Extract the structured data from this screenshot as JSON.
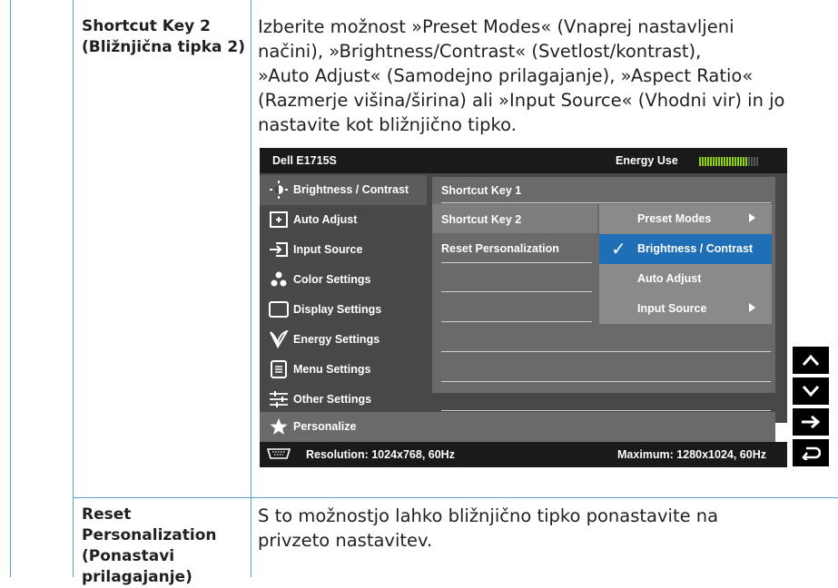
{
  "rows": [
    {
      "title_lines": [
        "Shortcut Key 2",
        "(Bližnjična tipka 2)"
      ],
      "description_lines": [
        "Izberite možnost »Preset Modes« (Vnaprej nastavljeni",
        "načini), »Brightness/Contrast« (Svetlost/kontrast),",
        "»Auto Adjust« (Samodejno prilagajanje), »Aspect Ratio«",
        "(Razmerje višina/širina) ali »Input Source« (Vhodni vir) in jo",
        "nastavite kot bližnjično tipko."
      ]
    },
    {
      "title_lines": [
        "Reset",
        "Personalization",
        "(Ponastavi",
        "prilagajanje)"
      ],
      "description_lines": [
        "S to možnostjo lahko bližnjično tipko ponastavite na",
        "privzeto nastavitev."
      ]
    }
  ],
  "osd": {
    "model": "Dell E1715S",
    "energy_label": "Energy Use",
    "energy_level_fraction": 0.83,
    "menu_items": [
      {
        "label": "Brightness / Contrast",
        "icon": "brightness-icon"
      },
      {
        "label": "Auto Adjust",
        "icon": "auto-adjust-icon"
      },
      {
        "label": "Input Source",
        "icon": "input-source-icon"
      },
      {
        "label": "Color Settings",
        "icon": "color-settings-icon"
      },
      {
        "label": "Display Settings",
        "icon": "display-settings-icon"
      },
      {
        "label": "Energy Settings",
        "icon": "energy-settings-icon"
      },
      {
        "label": "Menu Settings",
        "icon": "menu-settings-icon"
      },
      {
        "label": "Other Settings",
        "icon": "other-settings-icon"
      },
      {
        "label": "Personalize",
        "icon": "star-icon"
      }
    ],
    "personalize_items": [
      "Shortcut Key 1",
      "Shortcut Key 2",
      "Reset Personalization"
    ],
    "shortcut_options": [
      {
        "label": "Preset Modes",
        "has_submenu": true,
        "selected": false
      },
      {
        "label": "Brightness / Contrast",
        "has_submenu": false,
        "selected": true
      },
      {
        "label": "Auto Adjust",
        "has_submenu": false,
        "selected": false
      },
      {
        "label": "Input Source",
        "has_submenu": true,
        "selected": false
      }
    ],
    "footer_resolution": "Resolution: 1024x768, 60Hz",
    "footer_maximum": "Maximum: 1280x1024, 60Hz"
  },
  "side_buttons": [
    "up-arrow-icon",
    "down-arrow-icon",
    "right-arrow-icon",
    "back-icon"
  ],
  "colors": {
    "grid_line": "#5b9bd5",
    "osd_background": "#484848",
    "osd_highlight": "#1e6fb5",
    "energy_bar": "#8fd400"
  }
}
